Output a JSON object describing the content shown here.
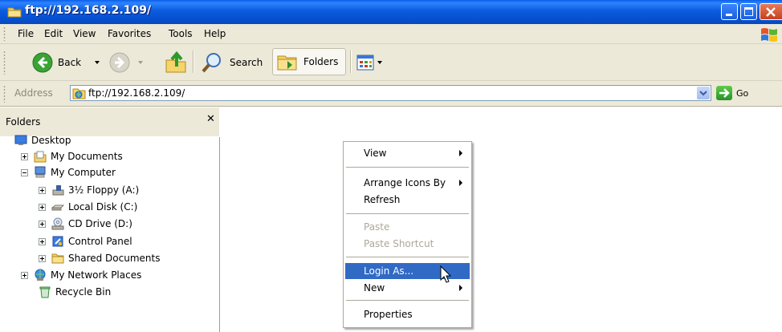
{
  "window": {
    "title": "ftp://192.168.2.109/"
  },
  "menubar": {
    "items": [
      "File",
      "Edit",
      "View",
      "Favorites",
      "Tools",
      "Help"
    ]
  },
  "toolbar": {
    "back_label": "Back",
    "search_label": "Search",
    "folders_label": "Folders"
  },
  "address": {
    "label": "Address",
    "value": "ftp://192.168.2.109/",
    "go_label": "Go"
  },
  "folders_pane": {
    "title": "Folders",
    "tree": [
      {
        "label": "Desktop",
        "icon": "desktop-icon"
      },
      {
        "label": "My Documents",
        "icon": "my-documents-icon",
        "expander": "plus"
      },
      {
        "label": "My Computer",
        "icon": "my-computer-icon",
        "expander": "minus"
      },
      {
        "label": "3½ Floppy (A:)",
        "icon": "floppy-drive-icon",
        "expander": "plus"
      },
      {
        "label": "Local Disk (C:)",
        "icon": "local-disk-icon",
        "expander": "plus"
      },
      {
        "label": "CD Drive (D:)",
        "icon": "cd-drive-icon",
        "expander": "plus"
      },
      {
        "label": "Control Panel",
        "icon": "control-panel-icon",
        "expander": "plus"
      },
      {
        "label": "Shared Documents",
        "icon": "folder-icon",
        "expander": "plus"
      },
      {
        "label": "My Network Places",
        "icon": "network-places-icon",
        "expander": "plus"
      },
      {
        "label": "Recycle Bin",
        "icon": "recycle-bin-icon"
      }
    ]
  },
  "context_menu": {
    "items": [
      {
        "label": "View",
        "submenu": true
      },
      {
        "label": "Arrange Icons By",
        "submenu": true
      },
      {
        "label": "Refresh"
      },
      {
        "label": "Paste",
        "disabled": true
      },
      {
        "label": "Paste Shortcut",
        "disabled": true
      },
      {
        "label": "Login As...",
        "selected": true
      },
      {
        "label": "New",
        "submenu": true
      },
      {
        "label": "Properties"
      }
    ]
  },
  "colors": {
    "titlebar": "#0b5bdc",
    "selection": "#316ac5",
    "chrome": "#ece9d8"
  }
}
